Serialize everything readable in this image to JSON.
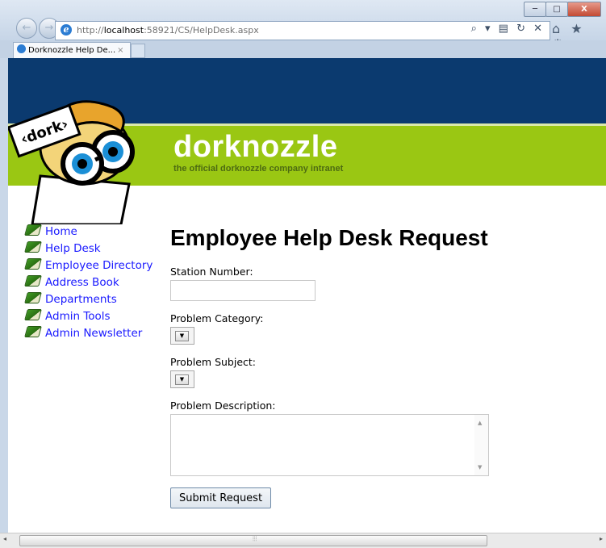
{
  "browser": {
    "url_prefix": "http://",
    "url_host": "localhost",
    "url_rest": ":58921/CS/HelpDesk.aspx",
    "tab_title": "Dorknozzle Help De...",
    "tab_close": "×",
    "back_glyph": "←",
    "forward_glyph": "→",
    "address_icons": "⌕ ▾ ▤ ↻ ✕",
    "toolbar_icons": "⌂ ★ ⚙",
    "window_buttons": {
      "minimize": "─",
      "maximize": "□",
      "close": "X"
    }
  },
  "header": {
    "brand_name": "dorknozzle",
    "tagline": "the official dorknozzle company intranet",
    "logo_sign": "‹dork›",
    "colors": {
      "top": "#0b3a6f",
      "band": "#9ac713"
    }
  },
  "nav": {
    "items": [
      {
        "label": "Home"
      },
      {
        "label": "Help Desk"
      },
      {
        "label": "Employee Directory"
      },
      {
        "label": "Address Book"
      },
      {
        "label": "Departments"
      },
      {
        "label": "Admin Tools"
      },
      {
        "label": "Admin Newsletter"
      }
    ]
  },
  "form": {
    "title": "Employee Help Desk Request",
    "station_label": "Station Number:",
    "station_value": "",
    "category_label": "Problem Category:",
    "category_value": "",
    "subject_label": "Problem Subject:",
    "subject_value": "",
    "description_label": "Problem Description:",
    "description_value": "",
    "submit_label": "Submit Request"
  },
  "scrollbar": {
    "grip": "⦙⦙⦙",
    "left": "◂",
    "right": "▸"
  }
}
